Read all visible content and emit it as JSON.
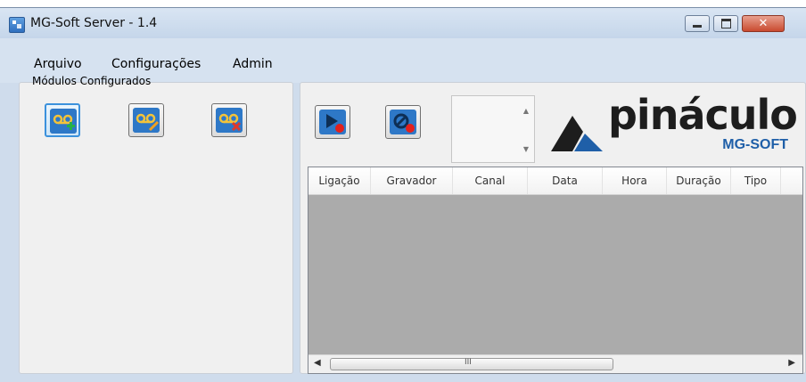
{
  "window": {
    "title": "MG-Soft Server - 1.4",
    "buttons": {
      "close_glyph": "✕"
    }
  },
  "menu": [
    "Arquivo",
    "Configurações",
    "Admin"
  ],
  "modules_group": {
    "label": "Módulos Configurados"
  },
  "toolbar_left": [
    {
      "name": "add-module",
      "icon": "voicemail-add-icon"
    },
    {
      "name": "edit-module",
      "icon": "voicemail-edit-icon"
    },
    {
      "name": "delete-module",
      "icon": "voicemail-delete-icon"
    }
  ],
  "toolbar_right": [
    {
      "name": "start-record",
      "icon": "play-record-icon"
    },
    {
      "name": "stop-record",
      "icon": "block-record-icon"
    }
  ],
  "logo": {
    "text": "pináculo",
    "sub": "MG-SOFT",
    "accent": "#1f5fa8"
  },
  "table": {
    "columns": [
      "Ligação",
      "Gravador",
      "Canal",
      "Data",
      "Hora",
      "Duração",
      "Tipo"
    ],
    "rows": []
  },
  "scrollbar": {
    "grip": "III"
  }
}
